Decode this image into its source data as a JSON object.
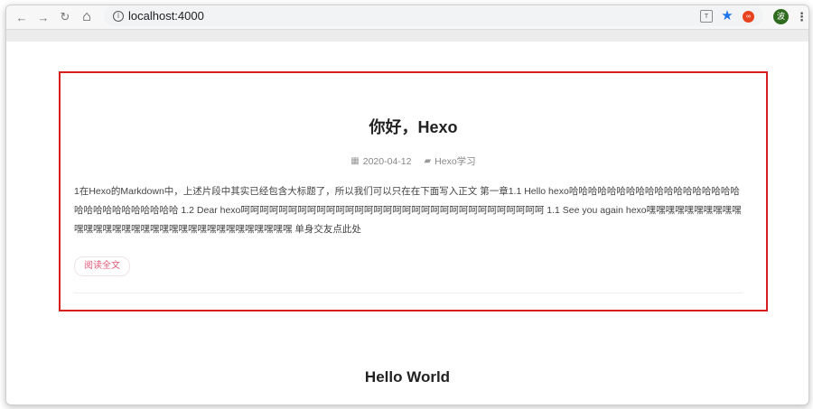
{
  "browser": {
    "url": "localhost:4000",
    "info_icon": "i",
    "back_icon": "←",
    "forward_icon": "→",
    "reload_icon": "↻",
    "home_icon": "⌂",
    "translate_icon": "T",
    "star_icon": "★",
    "extension_icon": "∞",
    "avatar_text": "波",
    "menu_icon": "⋮"
  },
  "post": {
    "title": "你好，Hexo",
    "date_icon": "▦",
    "date": "2020-04-12",
    "category_icon": "▰",
    "category": "Hexo学习",
    "excerpt": "1在Hexo的Markdown中，上述片段中其实已经包含大标题了，所以我们可以只在在下面写入正文 第一章1.1 Hello hexo哈哈哈哈哈哈哈哈哈哈哈哈哈哈哈哈哈哈哈哈哈哈哈哈哈哈哈哈哈 1.2 Dear hexo呵呵呵呵呵呵呵呵呵呵呵呵呵呵呵呵呵呵呵呵呵呵呵呵呵呵呵呵呵呵呵呵 1.1 See you again hexo嘿嘿嘿嘿嘿嘿嘿嘿嘿嘿嘿嘿嘿嘿嘿嘿嘿嘿嘿嘿嘿嘿嘿嘿嘿嘿嘿嘿嘿嘿嘿嘿嘿 单身交友点此处",
    "read_more": "阅读全文"
  },
  "next_post": {
    "title": "Hello World"
  }
}
